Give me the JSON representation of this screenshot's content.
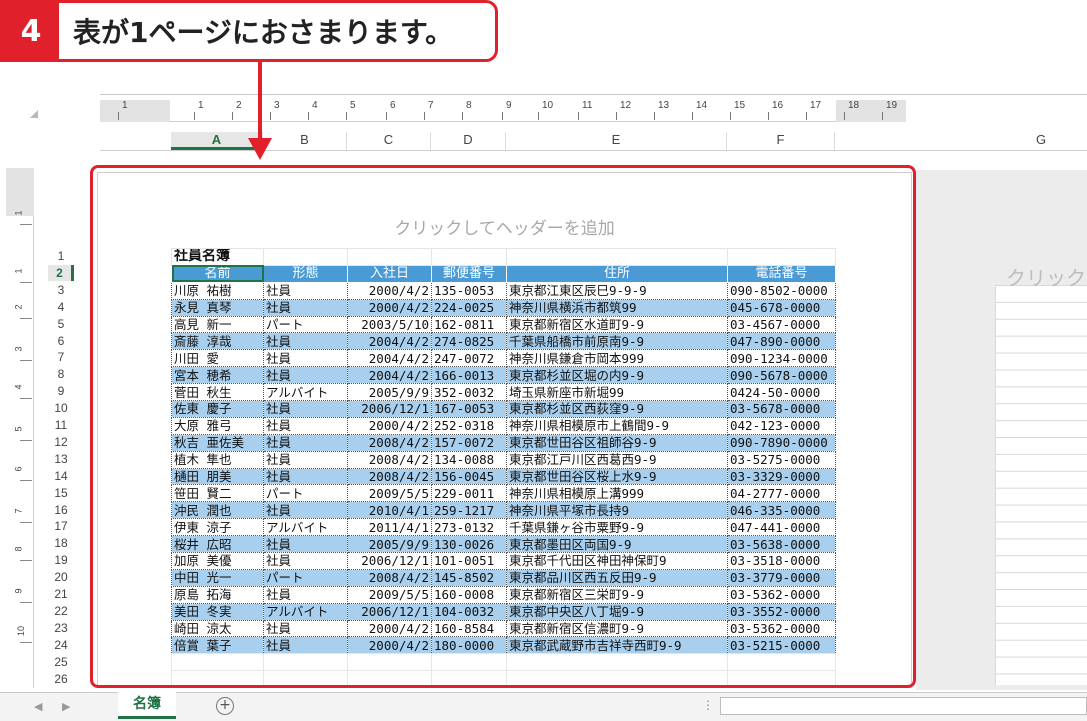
{
  "callout": {
    "step": "4",
    "text": "表が1ページにおさまります。"
  },
  "ruler": {
    "h_labels": [
      "1",
      "1",
      "2",
      "3",
      "4",
      "5",
      "6",
      "7",
      "8",
      "9",
      "10",
      "11",
      "12",
      "13",
      "14",
      "15",
      "16",
      "17",
      "18",
      "19"
    ],
    "v_labels": [
      "1",
      "1",
      "2",
      "3",
      "4",
      "5",
      "6",
      "7",
      "8",
      "9",
      "10"
    ]
  },
  "columns": [
    "A",
    "B",
    "C",
    "D",
    "E",
    "F",
    "G"
  ],
  "page": {
    "header_hint": "クリックしてヘッダーを追加",
    "right_hint": "クリックし"
  },
  "sheet": {
    "title": "社員名簿",
    "headers": [
      "名前",
      "形態",
      "入社日",
      "郵便番号",
      "住所",
      "電話番号"
    ],
    "rows": [
      [
        "川原 祐樹",
        "社員",
        "2000/4/2",
        "135-0053",
        "東京都江東区辰巳9-9-9",
        "090-8502-0000"
      ],
      [
        "永見 真琴",
        "社員",
        "2000/4/2",
        "224-0025",
        "神奈川県横浜市都筑99",
        "045-678-0000"
      ],
      [
        "高見 新一",
        "パート",
        "2003/5/10",
        "162-0811",
        "東京都新宿区水道町9-9",
        "03-4567-0000"
      ],
      [
        "斎藤 淳哉",
        "社員",
        "2004/4/2",
        "274-0825",
        "千葉県船橋市前原南9-9",
        "047-890-0000"
      ],
      [
        "川田 愛",
        "社員",
        "2004/4/2",
        "247-0072",
        "神奈川県鎌倉市岡本999",
        "090-1234-0000"
      ],
      [
        "宮本 穂希",
        "社員",
        "2004/4/2",
        "166-0013",
        "東京都杉並区堀の内9-9",
        "090-5678-0000"
      ],
      [
        "菅田 秋生",
        "アルバイト",
        "2005/9/9",
        "352-0032",
        "埼玉県新座市新堀99",
        "0424-50-0000"
      ],
      [
        "佐東 慶子",
        "社員",
        "2006/12/1",
        "167-0053",
        "東京都杉並区西荻窪9-9",
        "03-5678-0000"
      ],
      [
        "大原 雅弓",
        "社員",
        "2000/4/2",
        "252-0318",
        "神奈川県相模原市上鶴間9-9",
        "042-123-0000"
      ],
      [
        "秋吉 亜佐美",
        "社員",
        "2008/4/2",
        "157-0072",
        "東京都世田谷区祖師谷9-9",
        "090-7890-0000"
      ],
      [
        "植木 隼也",
        "社員",
        "2008/4/2",
        "134-0088",
        "東京都江戸川区西葛西9-9",
        "03-5275-0000"
      ],
      [
        "樋田 朋美",
        "社員",
        "2008/4/2",
        "156-0045",
        "東京都世田谷区桜上水9-9",
        "03-3329-0000"
      ],
      [
        "笹田 賢二",
        "パート",
        "2009/5/5",
        "229-0011",
        "神奈川県相模原上溝999",
        "04-2777-0000"
      ],
      [
        "沖民 潤也",
        "社員",
        "2010/4/1",
        "259-1217",
        "神奈川県平塚市長持9",
        "046-335-0000"
      ],
      [
        "伊東 涼子",
        "アルバイト",
        "2011/4/1",
        "273-0132",
        "千葉県鎌ヶ谷市粟野9-9",
        "047-441-0000"
      ],
      [
        "桜井 広昭",
        "社員",
        "2005/9/9",
        "130-0026",
        "東京都墨田区両国9-9",
        "03-5638-0000"
      ],
      [
        "加原 美優",
        "社員",
        "2006/12/1",
        "101-0051",
        "東京都千代田区神田神保町9",
        "03-3518-0000"
      ],
      [
        "中田 光一",
        "パート",
        "2008/4/2",
        "145-8502",
        "東京都品川区西五反田9-9",
        "03-3779-0000"
      ],
      [
        "原島 拓海",
        "社員",
        "2009/5/5",
        "160-0008",
        "東京都新宿区三栄町9-9",
        "03-5362-0000"
      ],
      [
        "美田 冬実",
        "アルバイト",
        "2006/12/1",
        "104-0032",
        "東京都中央区八丁堀9-9",
        "03-3552-0000"
      ],
      [
        "崎田 涼太",
        "社員",
        "2000/4/2",
        "160-8584",
        "東京都新宿区信濃町9-9",
        "03-5362-0000"
      ],
      [
        "倍賞 葉子",
        "社員",
        "2000/4/2",
        "180-0000",
        "東京都武蔵野市吉祥寺西町9-9",
        "03-5215-0000"
      ]
    ]
  },
  "row_numbers": [
    "1",
    "2",
    "3",
    "4",
    "5",
    "6",
    "7",
    "8",
    "9",
    "10",
    "11",
    "12",
    "13",
    "14",
    "15",
    "16",
    "17",
    "18",
    "19",
    "20",
    "21",
    "22",
    "23",
    "24",
    "25",
    "26"
  ],
  "tabs": {
    "sheet_name": "名簿",
    "add_symbol": "+"
  },
  "colors": {
    "accent_red": "#e0202b",
    "excel_green": "#217346",
    "header_blue": "#4a9ad6",
    "band_blue": "#a8cfee"
  }
}
